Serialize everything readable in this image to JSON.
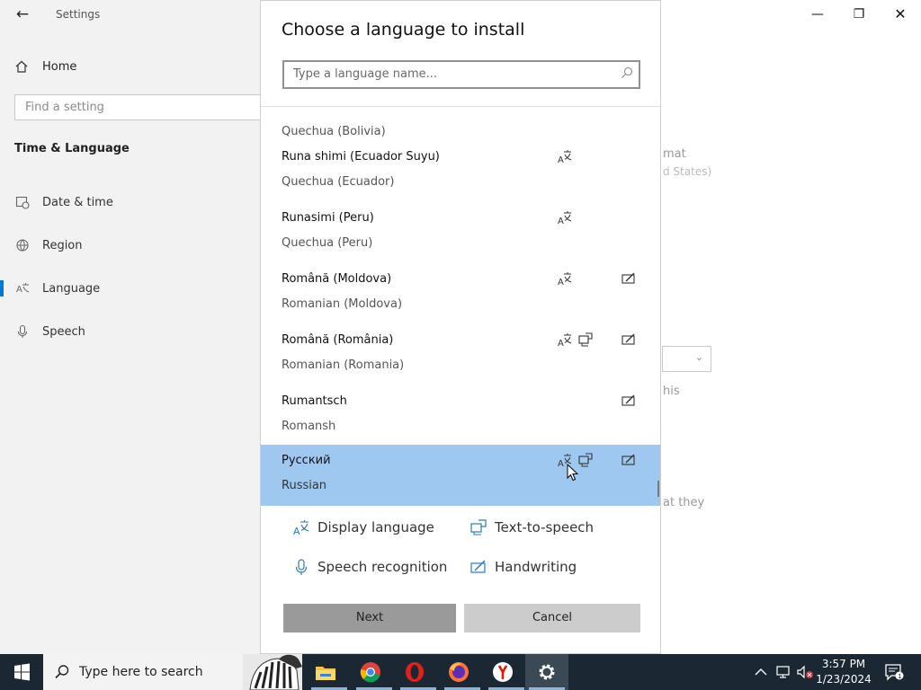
{
  "window": {
    "app_title": "Settings",
    "back_icon": "back-arrow-icon",
    "min_glyph": "—",
    "max_glyph": "❐",
    "close_glyph": "✕"
  },
  "sidebar": {
    "home_label": "Home",
    "search_placeholder": "Find a setting",
    "section_title": "Time & Language",
    "items": [
      {
        "label": "Date & time",
        "icon": "calendar-clock-icon",
        "selected": false
      },
      {
        "label": "Region",
        "icon": "globe-icon",
        "selected": false
      },
      {
        "label": "Language",
        "icon": "language-icon",
        "selected": true
      },
      {
        "label": "Speech",
        "icon": "microphone-icon",
        "selected": false
      }
    ]
  },
  "background": {
    "text1": "mat",
    "text2": "d States)",
    "text3": "his",
    "text4": "at they"
  },
  "dialog": {
    "title": "Choose a language to install",
    "search_placeholder": "Type a language name...",
    "partial_item": "Quechua (Bolivia)",
    "languages": [
      {
        "native": "Runa shimi (Ecuador Suyu)",
        "english": "Quechua (Ecuador)",
        "display": true,
        "tts": false,
        "handwriting": false,
        "selected": false
      },
      {
        "native": "Runasimi (Peru)",
        "english": "Quechua (Peru)",
        "display": true,
        "tts": false,
        "handwriting": false,
        "selected": false
      },
      {
        "native": "Română (Moldova)",
        "english": "Romanian (Moldova)",
        "display": true,
        "tts": false,
        "handwriting": true,
        "selected": false
      },
      {
        "native": "Română (România)",
        "english": "Romanian (Romania)",
        "display": true,
        "tts": true,
        "handwriting": true,
        "selected": false
      },
      {
        "native": "Rumantsch",
        "english": "Romansh",
        "display": false,
        "tts": false,
        "handwriting": true,
        "selected": false
      },
      {
        "native": "Русский",
        "english": "Russian",
        "display": true,
        "tts": true,
        "handwriting": true,
        "selected": true
      }
    ],
    "legend": {
      "display": "Display language",
      "tts": "Text-to-speech",
      "speech": "Speech recognition",
      "handwriting": "Handwriting"
    },
    "next_label": "Next",
    "cancel_label": "Cancel"
  },
  "taskbar": {
    "search_text": "Type here to search",
    "pinned": [
      "file-explorer-icon",
      "chrome-icon",
      "opera-icon",
      "firefox-icon",
      "yandex-icon",
      "settings-gear-icon"
    ],
    "time": "3:57 PM",
    "date": "1/23/2024"
  },
  "colors": {
    "selection": "#9ec8ef",
    "accent": "#0078d7",
    "taskbar": "#1b2833"
  }
}
